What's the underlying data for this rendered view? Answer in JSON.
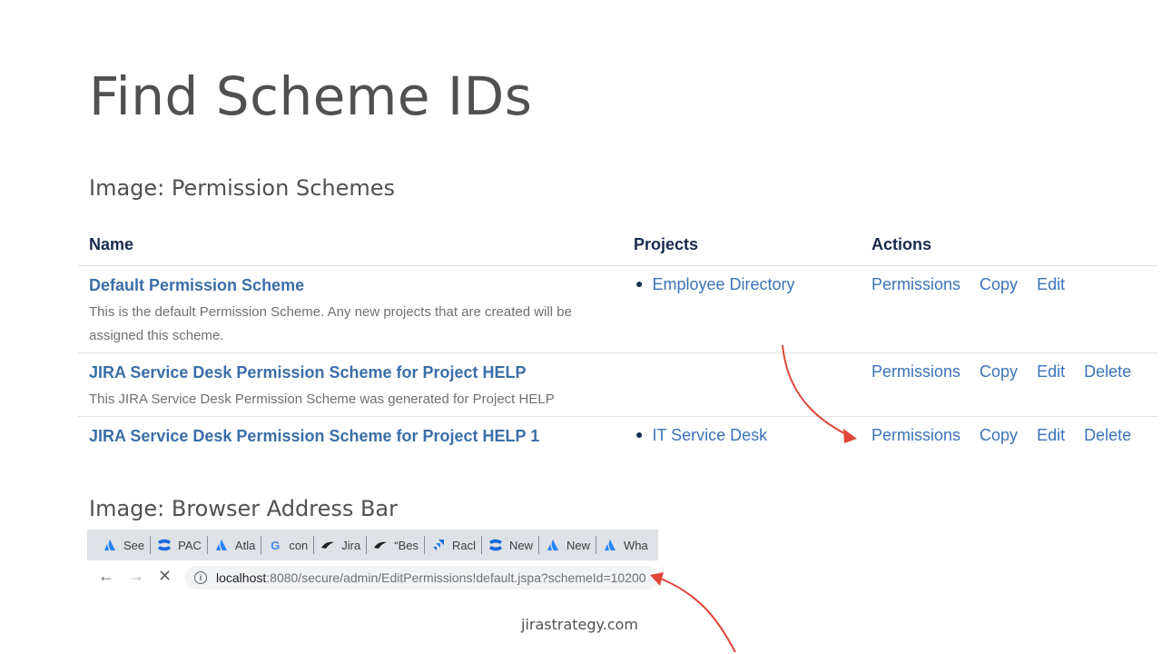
{
  "slide": {
    "title": "Find Scheme IDs",
    "caption_table": "Image: Permission Schemes",
    "caption_browser": "Image: Browser Address Bar",
    "footer": "jirastrategy.com"
  },
  "table": {
    "headers": {
      "name": "Name",
      "projects": "Projects",
      "actions": "Actions"
    },
    "rows": [
      {
        "name": "Default Permission Scheme",
        "description": "This is the default Permission Scheme. Any new projects that are created will be assigned this scheme.",
        "project": "Employee Directory",
        "actions": [
          "Permissions",
          "Copy",
          "Edit"
        ]
      },
      {
        "name": "JIRA Service Desk Permission Scheme for Project HELP",
        "description": "This JIRA Service Desk Permission Scheme was generated for Project HELP",
        "project": "",
        "actions": [
          "Permissions",
          "Copy",
          "Edit",
          "Delete"
        ]
      },
      {
        "name": "JIRA Service Desk Permission Scheme for Project HELP 1",
        "description": "",
        "project": "IT Service Desk",
        "actions": [
          "Permissions",
          "Copy",
          "Edit",
          "Delete"
        ]
      }
    ]
  },
  "browser": {
    "tabs": [
      {
        "label": "See",
        "icon": "atlassian-icon"
      },
      {
        "label": "PAC",
        "icon": "confluence-icon"
      },
      {
        "label": "Atla",
        "icon": "atlassian-icon"
      },
      {
        "label": "con",
        "icon": "google-icon"
      },
      {
        "label": "Jira",
        "icon": "bird-icon"
      },
      {
        "label": "“Bes",
        "icon": "bird-icon"
      },
      {
        "label": "Racl",
        "icon": "jira-icon"
      },
      {
        "label": "New",
        "icon": "confluence-icon"
      },
      {
        "label": "New",
        "icon": "atlassian-icon"
      },
      {
        "label": "Wha",
        "icon": "atlassian-icon"
      }
    ],
    "url_host": "localhost",
    "url_path": ":8080/secure/admin/EditPermissions!default.jspa?schemeId=10200"
  },
  "colors": {
    "link": "#3b73b9",
    "arrow": "#e0473a",
    "tab_strip": "#dee1e6"
  }
}
